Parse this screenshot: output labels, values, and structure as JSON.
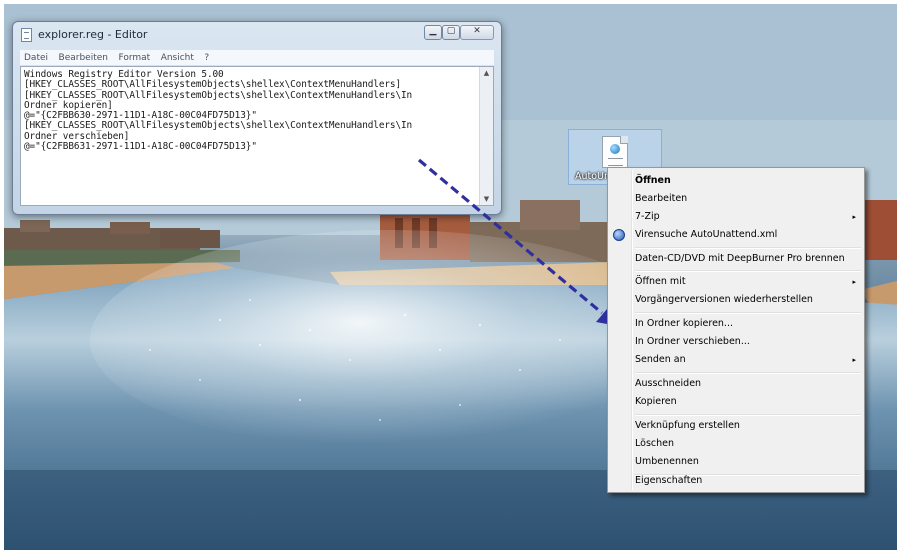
{
  "editor": {
    "title": "explorer.reg - Editor",
    "menu": [
      "Datei",
      "Bearbeiten",
      "Format",
      "Ansicht",
      "?"
    ],
    "content": "Windows Registry Editor Version 5.00\n[HKEY_CLASSES_ROOT\\AllFilesystemObjects\\shellex\\ContextMenuHandlers]\n[HKEY_CLASSES_ROOT\\AllFilesystemObjects\\shellex\\ContextMenuHandlers\\In\nOrdner kopieren]\n@=\"{C2FBB630-2971-11D1-A18C-00C04FD75D13}\"\n[HKEY_CLASSES_ROOT\\AllFilesystemObjects\\shellex\\ContextMenuHandlers\\In\nOrdner verschieben]\n@=\"{C2FBB631-2971-11D1-A18C-00C04FD75D13}\""
  },
  "desktop_file": {
    "label": "AutoUn"
  },
  "context_menu": {
    "items": [
      {
        "label": "Öffnen"
      },
      {
        "label": "Bearbeiten"
      },
      {
        "label": "7-Zip",
        "submenu_glyph": "▸"
      },
      {
        "label": "Virensuche AutoUnattend.xml",
        "icon": "shield-icon"
      },
      {
        "label": "Daten-CD/DVD mit DeepBurner Pro brennen"
      },
      {
        "label": "Öffnen mit",
        "submenu_glyph": "▸"
      },
      {
        "label": "Vorgängerversionen wiederherstellen"
      },
      {
        "label": "In Ordner kopieren..."
      },
      {
        "label": "In Ordner verschieben..."
      },
      {
        "label": "Senden an",
        "submenu_glyph": "▸"
      },
      {
        "label": "Ausschneiden"
      },
      {
        "label": "Kopieren"
      },
      {
        "label": "Verknüpfung erstellen"
      },
      {
        "label": "Löschen"
      },
      {
        "label": "Umbenennen"
      },
      {
        "label": "Eigenschaften"
      }
    ]
  },
  "annotation": {
    "arrow_color": "#2f2f9e"
  }
}
